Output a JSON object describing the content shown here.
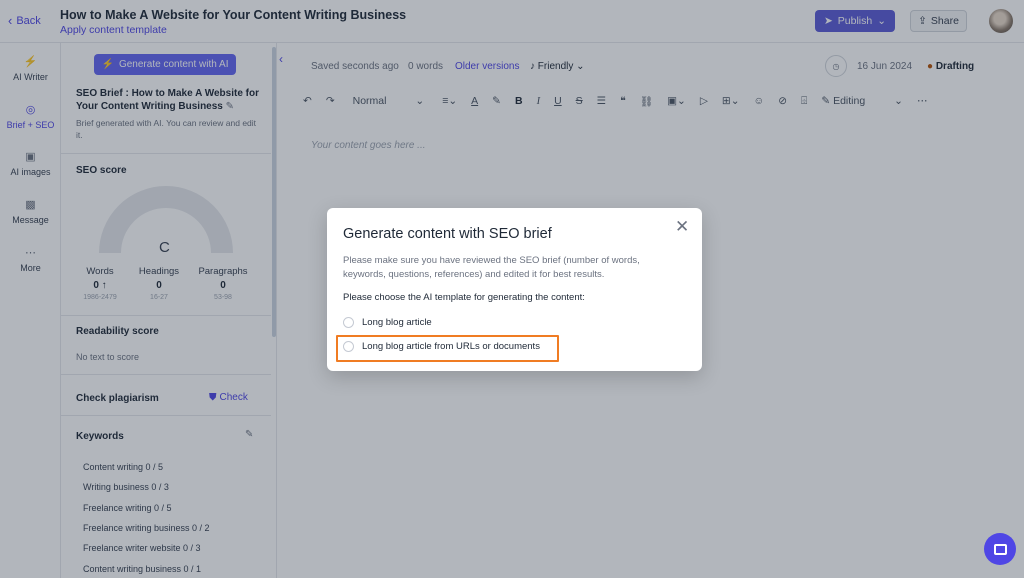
{
  "header": {
    "back_label": "Back",
    "doc_title": "How to Make A Website for Your Content Writing Business",
    "doc_subtitle": "Apply content template",
    "publish_label": "Publish",
    "share_label": "Share"
  },
  "rail": {
    "items": [
      {
        "label": "AI Writer",
        "icon": "lightning-icon"
      },
      {
        "label": "Brief + SEO",
        "icon": "target-icon"
      },
      {
        "label": "AI images",
        "icon": "image-icon"
      },
      {
        "label": "Message",
        "icon": "message-icon"
      },
      {
        "label": "More",
        "icon": "more-icon"
      }
    ]
  },
  "brief": {
    "generate_label": "Generate content with AI",
    "title": "SEO Brief : How to Make A Website for Your Content Writing Business",
    "note": "Brief generated with AI. You can review and edit it.",
    "seo_score_label": "SEO score",
    "seo_grade": "C",
    "stats": [
      {
        "label": "Words",
        "value": "0 ↑",
        "range": "1986-2479"
      },
      {
        "label": "Headings",
        "value": "0",
        "range": "16-27"
      },
      {
        "label": "Paragraphs",
        "value": "0",
        "range": "53-98"
      }
    ],
    "readability_label": "Readability score",
    "readability_value": "No text to score",
    "plagiarism_label": "Check plagiarism",
    "plagiarism_action": "Check",
    "keywords_label": "Keywords",
    "keywords": [
      "Content writing  0 / 5",
      "Writing business  0 / 3",
      "Freelance writing  0 / 5",
      "Freelance writing business  0 / 2",
      "Freelance writer website  0 / 3",
      "Content writing business  0 / 1"
    ]
  },
  "editor": {
    "saved_status": "Saved seconds ago",
    "word_count": "0 words",
    "older_versions": "Older versions",
    "tone": "Friendly",
    "date": "16 Jun 2024",
    "status": "Drafting",
    "style_select": "Normal",
    "mode_select": "Editing",
    "placeholder": "Your content goes here ..."
  },
  "modal": {
    "title": "Generate content with SEO brief",
    "description": "Please make sure you have reviewed the SEO brief (number of words, keywords, questions, references) and edited it for best results.",
    "question": "Please choose the AI template for generating the content:",
    "options": [
      "Long blog article",
      "Long blog article from URLs or documents"
    ]
  },
  "colors": {
    "accent": "#4f46e5",
    "highlight": "#f07c23"
  }
}
